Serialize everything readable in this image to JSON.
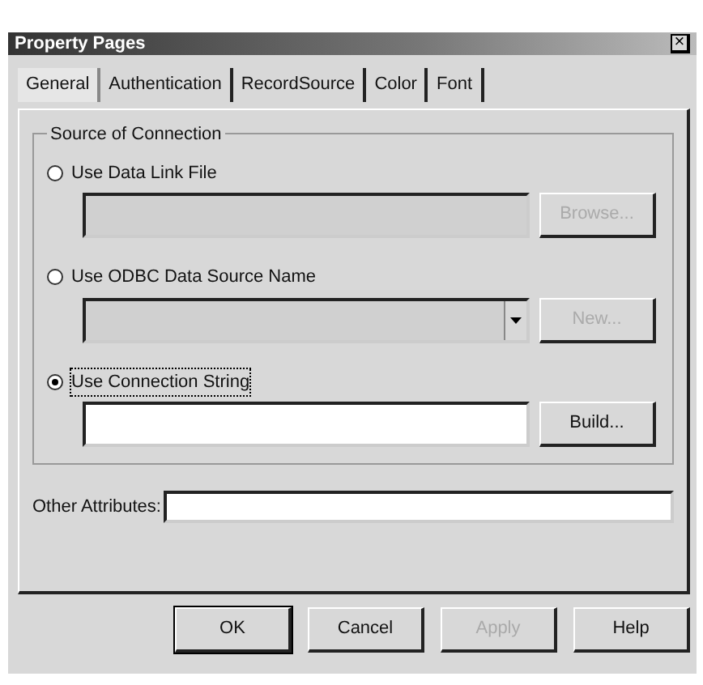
{
  "window": {
    "title": "Property Pages",
    "close": "×"
  },
  "tabs": [
    {
      "label": "General",
      "selected": true
    },
    {
      "label": "Authentication",
      "selected": false
    },
    {
      "label": "RecordSource",
      "selected": false
    },
    {
      "label": "Color",
      "selected": false
    },
    {
      "label": "Font",
      "selected": false
    }
  ],
  "group": {
    "title": "Source of Connection",
    "options": [
      {
        "label": "Use Data Link File",
        "selected": false,
        "kind": "text",
        "button": {
          "label": "Browse...",
          "disabled": true
        }
      },
      {
        "label": "Use ODBC Data Source Name",
        "selected": false,
        "kind": "combo",
        "button": {
          "label": "New...",
          "disabled": true
        }
      },
      {
        "label": "Use Connection String",
        "selected": true,
        "kind": "text",
        "button": {
          "label": "Build...",
          "disabled": false
        }
      }
    ]
  },
  "other_attributes": {
    "label": "Other Attributes:"
  },
  "buttons": [
    {
      "label": "OK",
      "disabled": false,
      "default": true
    },
    {
      "label": "Cancel",
      "disabled": false,
      "default": false
    },
    {
      "label": "Apply",
      "disabled": true,
      "default": false
    },
    {
      "label": "Help",
      "disabled": false,
      "default": false
    }
  ]
}
